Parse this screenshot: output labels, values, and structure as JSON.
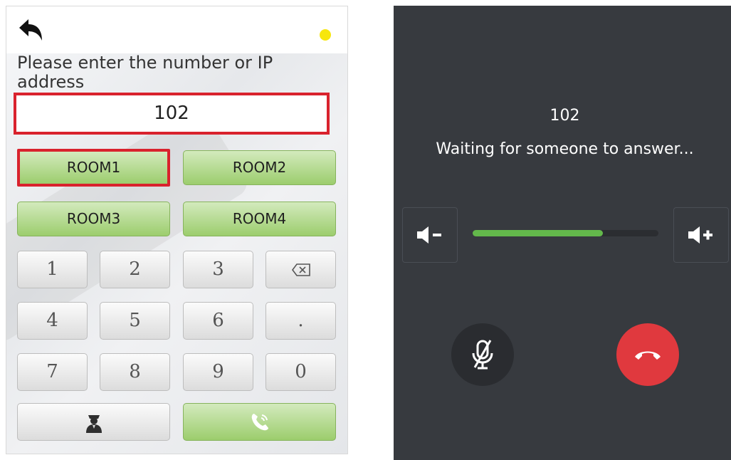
{
  "colors": {
    "accent_red": "#d9222d",
    "room_green": "#9ccd6d",
    "status_dot": "#f7e60d",
    "call_bg": "#373a3f",
    "volume_fill": "#63b84b",
    "hangup_red": "#e0393e"
  },
  "dial": {
    "back_icon": "back-arrow-icon",
    "status_indicator": "yellow-dot",
    "prompt": "Please enter the number or IP address",
    "number_value": "102",
    "rooms": [
      "ROOM1",
      "ROOM2",
      "ROOM3",
      "ROOM4"
    ],
    "keypad": [
      "1",
      "2",
      "3",
      "backspace-icon",
      "4",
      "5",
      "6",
      ".",
      "7",
      "8",
      "9",
      "0"
    ],
    "security_icon": "security-guard-icon",
    "call_icon": "phone-call-icon"
  },
  "call": {
    "number": "102",
    "status": "Waiting for someone to answer...",
    "volume_level": 0.7,
    "volume_down_icon": "volume-down-icon",
    "volume_up_icon": "volume-up-icon",
    "mute_icon": "microphone-muted-icon",
    "hangup_icon": "hang-up-icon"
  }
}
